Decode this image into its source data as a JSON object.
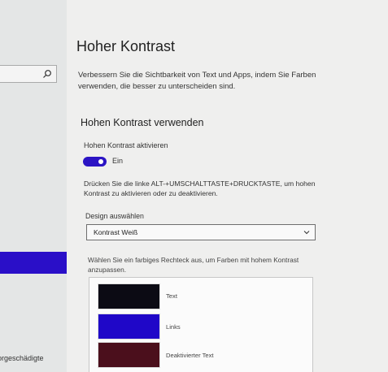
{
  "sidebar": {
    "search_placeholder": "",
    "bottom_item_label": "orgeschädigte"
  },
  "page": {
    "title": "Hoher Kontrast",
    "intro": "Verbessern Sie die Sichtbarkeit von Text und Apps, indem Sie Farben verwenden, die besser zu unterscheiden sind."
  },
  "section": {
    "heading": "Hohen Kontrast verwenden"
  },
  "toggle": {
    "label": "Hohen Kontrast aktivieren",
    "state_label": "Ein"
  },
  "shortcut": {
    "text": "Drücken Sie die linke ALT-+UMSCHALTTASTE+DRUCKTASTE, um hohen Kontrast zu aktivieren oder zu deaktivieren."
  },
  "design": {
    "label": "Design auswählen",
    "selected": "Kontrast Weiß"
  },
  "colors": {
    "instruction": "Wählen Sie ein farbiges Rechteck aus, um Farben mit hohem Kontrast anzupassen.",
    "items": [
      {
        "label": "Text",
        "color": "#0c0b14"
      },
      {
        "label": "Links",
        "color": "#1f07c8"
      },
      {
        "label": "Deaktivierter Text",
        "color": "#4b0f1c"
      }
    ]
  },
  "theme": {
    "accent": "#2b14c4"
  }
}
